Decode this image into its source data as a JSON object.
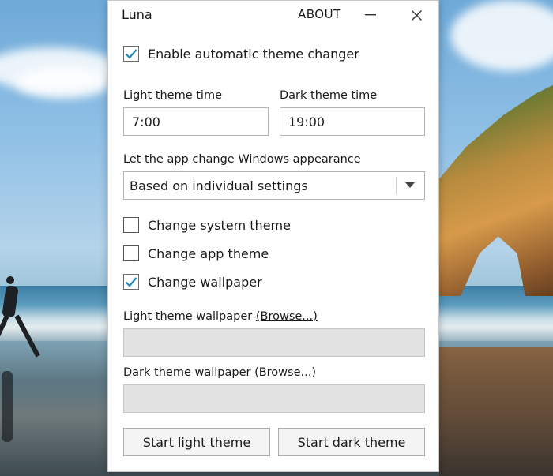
{
  "window": {
    "app_title": "Luna",
    "about_label": "ABOUT"
  },
  "auto_theme": {
    "label": "Enable automatic theme changer",
    "checked": true
  },
  "light_time": {
    "label": "Light theme time",
    "value": "7:00"
  },
  "dark_time": {
    "label": "Dark theme time",
    "value": "19:00"
  },
  "appearance": {
    "label": "Let the app change Windows appearance",
    "selected": "Based on individual settings"
  },
  "options": [
    {
      "label": "Change system theme",
      "checked": false
    },
    {
      "label": "Change app theme",
      "checked": false
    },
    {
      "label": "Change wallpaper",
      "checked": true
    }
  ],
  "light_wallpaper": {
    "label": "Light theme wallpaper",
    "browse": "(Browse...)",
    "path": ""
  },
  "dark_wallpaper": {
    "label": "Dark theme wallpaper",
    "browse": "(Browse...)",
    "path": ""
  },
  "buttons": {
    "start_light": "Start light theme",
    "start_dark": "Start dark theme"
  },
  "colors": {
    "checkmark": "#1e8ab8",
    "wallpaper_box": "#e2e2e2"
  }
}
